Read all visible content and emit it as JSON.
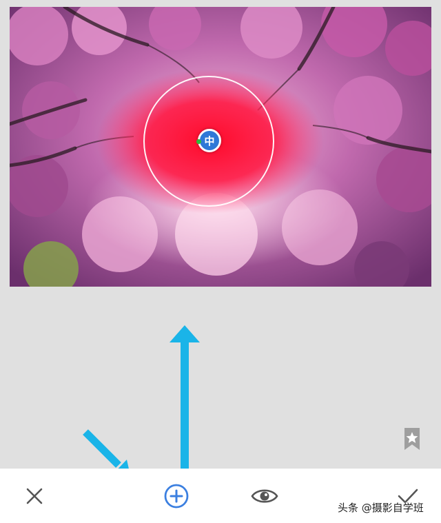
{
  "editor": {
    "point_label": "中",
    "ring_color": "#ffffff",
    "point_color": "#2f78d7",
    "arrow_color": "#1ab4e8"
  },
  "toolbar": {
    "cancel_icon": "close-icon",
    "add_icon": "add-circle-icon",
    "preview_icon": "eye-icon",
    "apply_icon": "check-icon",
    "accent": "#3b7fe0"
  },
  "side": {
    "styles_icon": "bookmark-star-icon"
  },
  "watermark": {
    "text": "头条 @摄影自学班"
  }
}
